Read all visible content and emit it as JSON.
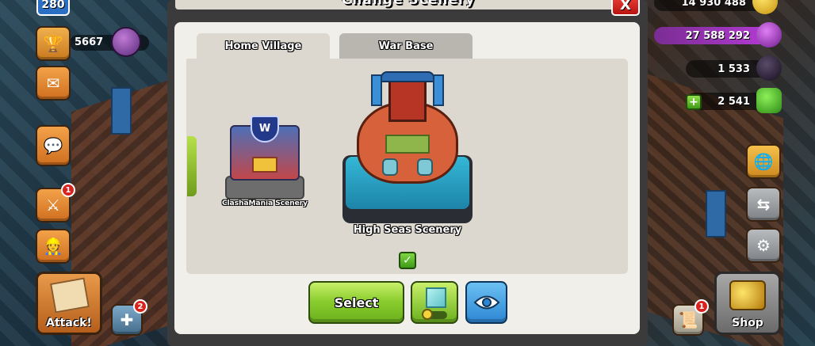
{
  "modal": {
    "title": "Change Scenery",
    "close_label": "X",
    "tabs": [
      {
        "label": "Home Village",
        "active": true
      },
      {
        "label": "War Base",
        "active": false
      }
    ],
    "sceneries": [
      {
        "name": "ClashaMania Scenery",
        "logo_text": "W",
        "selected": false
      },
      {
        "name": "High Seas Scenery",
        "selected": true
      }
    ],
    "select_label": "Select"
  },
  "hud_left": {
    "level": "280",
    "trophies": "5667",
    "attack_label": "Attack!",
    "notif_attack": "1",
    "notif_builder": "2"
  },
  "hud_right": {
    "gold": "14 930 488",
    "elixir": "27 588 292",
    "dark_elixir": "1 533",
    "gems": "2 541",
    "shop_label": "Shop",
    "notif_news": "1"
  },
  "colors": {
    "accent_green": "#88cc2c",
    "accent_blue": "#2d86d3",
    "close_red": "#d8231e",
    "elixir": "#b63bd6"
  }
}
